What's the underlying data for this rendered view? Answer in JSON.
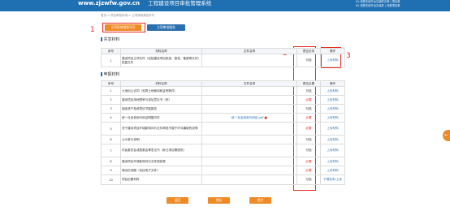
{
  "header": {
    "url": "www.zjzwfw.gov.cn",
    "system_title": "工程建设项目审批管理系统",
    "notice_lines": [
      "01.流受在线平台注销件办事 | 项目单",
      "02.流受在线平台办结件 | 流受项目单"
    ]
  },
  "breadcrumb": "首页 > 项目审批申请 > 立项用地规划许可",
  "tabs": [
    {
      "label": "立项用地规划许可"
    },
    {
      "label": "立项审批服务"
    }
  ],
  "markers": [
    "1",
    "2",
    "3"
  ],
  "shared": {
    "title": "共享材料",
    "headers": [
      "序号",
      "材料名称",
      "文件名称",
      "是否必传",
      "操作"
    ],
    "rows": [
      {
        "no": "1",
        "name": "建设项目立项文件（包括建设项目批准、核准、备案等文件）批复文件",
        "file": "",
        "req": "可选",
        "action": "上传材料"
      }
    ]
  },
  "declared": {
    "title": "申报材料",
    "headers": [
      "序号",
      "材料名称",
      "文件名称",
      "是否必要",
      "操作"
    ],
    "rows": [
      {
        "no": "1",
        "name": "土地出让合同（划拨土地使用权证明条件）",
        "file": "",
        "req": "可选",
        "action": "上传材料"
      },
      {
        "no": "2",
        "name": "建设项目用地预审与选址意见书（申）",
        "file": "",
        "req": "必要",
        "action": "上传材料"
      },
      {
        "no": "3",
        "name": "固定资产投资项目节能报告",
        "file": "",
        "req": "可选",
        "action": "上传材料"
      },
      {
        "no": "4",
        "name": "统一社会信用代码证明复印件",
        "file": "统一社会信用代码证.pdf",
        "req": "必要",
        "action": "上传材料"
      },
      {
        "no": "5",
        "name": "关于建设项目环境影响评价文件审批不属于环评编制的说明",
        "file": "",
        "req": "必要",
        "action": "上传材料"
      },
      {
        "no": "6",
        "name": "公众参与说明",
        "file": "",
        "req": "可选",
        "action": "上传材料"
      },
      {
        "no": "7",
        "name": "村民委员会或居委会等意见书（拆迁项目需提供）",
        "file": "",
        "req": "可选",
        "action": "上传材料"
      },
      {
        "no": "8",
        "name": "建设项目环境影响评价文件报批表",
        "file": "",
        "req": "必要",
        "action": "上传材料"
      },
      {
        "no": "9",
        "name": "周边红线图（包括电子文件）",
        "file": "",
        "req": "必要",
        "action": "上传材料"
      },
      {
        "no": "10",
        "name": "项目纪要材料",
        "file": "",
        "req": "可选",
        "action": "下载范本/上传"
      }
    ]
  },
  "footer_buttons": [
    {
      "label": "返回"
    },
    {
      "label": "保存"
    },
    {
      "label": "提交"
    }
  ],
  "float_button": "←",
  "colors": {
    "brand_blue": "#1f6fb3",
    "accent_orange": "#f08a24",
    "annotation_red": "#e8261c",
    "required_red": "#e8261c"
  }
}
